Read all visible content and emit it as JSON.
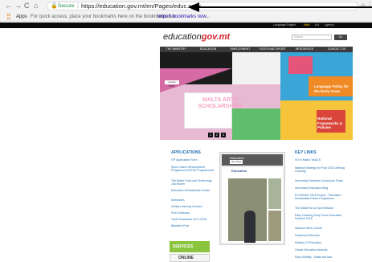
{
  "browser": {
    "url": "https://education.gov.mt/en/Pages/educ.aspx",
    "secure_label": "Secure",
    "apps_label": "Apps",
    "bookmarks_hint": "For quick access, place your bookmarks here on the bookmarks bar.",
    "import_link": "Import bookmarks now..."
  },
  "site": {
    "topbar": [
      "Language English",
      "Malti",
      "A A",
      "Agency"
    ],
    "logo_text": "education",
    "logo_tld": "gov.mt",
    "search_placeholder": "Search",
    "search_button": "Go",
    "main_nav": [
      "THE MINISTRY",
      "EDUCATION",
      "EMPLOYMENT",
      "YOUTH AND SPORT",
      "RESOURCES",
      "CONTACT US"
    ],
    "banner": {
      "cookie": "Cookie Policy",
      "scholarships": "MALTA ARTS SCHOLARSHIPS",
      "language": "Language Policy for the Early Years",
      "frameworks": "National Frameworks & Policies",
      "slides": [
        "1",
        "2",
        "3"
      ]
    },
    "applications": {
      "heading": "APPLICATIONS",
      "items": [
        "ITP Application Form",
        "Sport Career Development Programme (SCDP) Programme/s",
        "The Better Food and Technology Job Hunter",
        "Education Scholarships Grants",
        "Directories",
        "Infinity Learning Courses",
        "Fem Childcare",
        "Youth Guarantee 2017-2018",
        "Blackbird Fest"
      ]
    },
    "facebook": {
      "page_title": "Education",
      "like_label": "Like Page",
      "poster": "Education"
    },
    "services": {
      "label": "SERVICES",
      "online_label": "ONLINE"
    },
    "key_links": {
      "heading": "KEY LINKS",
      "items": [
        "VO in Malta / MaLTA",
        "National Strategy for Post 2020 Lifelong Learning",
        "Secondary Teachers Curriculum Portal",
        "Secondary Education Blog",
        "ECONOMY 2018 Project - Education Sustainable Future Programme",
        "The Malta Far as Spin Network",
        "Early Learning Shop Cross Education Scheme 2018",
        "National Work Counts",
        "Parliament Records",
        "Ministry Of Education",
        "Global Education Network",
        "Early Mobility - Malta and MaL"
      ]
    }
  }
}
